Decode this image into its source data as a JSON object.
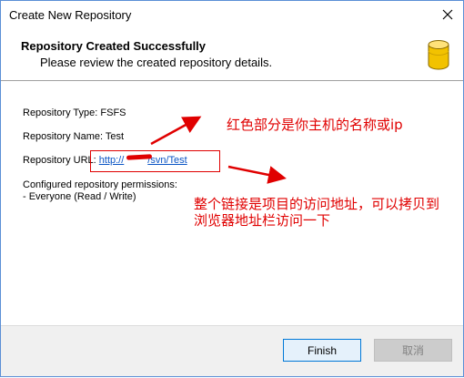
{
  "window": {
    "title": "Create New Repository",
    "close_glyph": "✕"
  },
  "header": {
    "title": "Repository Created Successfully",
    "subtitle": "Please review the created repository details.",
    "icon": "database-icon",
    "icon_color": "#f2c200"
  },
  "details": {
    "type_label": "Repository Type: FSFS",
    "name_label": "Repository Name: Test",
    "url_label": "Repository URL:",
    "url_value": "http://",
    "url_value_tail": "/svn/Test",
    "permissions_label": "Configured repository permissions:",
    "permissions_value": "- Everyone (Read / Write)"
  },
  "annotations": {
    "note1": "红色部分是你主机的名称或ip",
    "note2_line1": "整个链接是项目的访问地址，可以拷贝到",
    "note2_line2": "浏览器地址栏访问一下",
    "color": "#e00000"
  },
  "buttons": {
    "finish": "Finish",
    "cancel": "取消"
  }
}
